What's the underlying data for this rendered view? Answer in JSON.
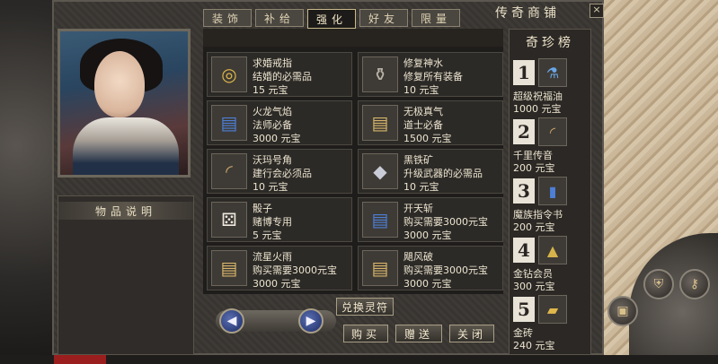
{
  "tabs": [
    {
      "label": "装饰",
      "active": false
    },
    {
      "label": "补给",
      "active": false
    },
    {
      "label": "强化",
      "active": true
    },
    {
      "label": "好友",
      "active": false
    },
    {
      "label": "限量",
      "active": false
    }
  ],
  "shop_title": "传奇商铺",
  "close_label": "×",
  "description_header": "物品说明",
  "items": [
    {
      "name": "求婚戒指",
      "desc": "结婚的必需品",
      "price": "15  元宝",
      "icon": "ring-icon"
    },
    {
      "name": "修复神水",
      "desc": "修复所有装备",
      "price": "10  元宝",
      "icon": "potion-icon"
    },
    {
      "name": "火龙气焰",
      "desc": "法师必备",
      "price": "3000  元宝",
      "icon": "book-icon"
    },
    {
      "name": "无极真气",
      "desc": "道士必备",
      "price": "1500  元宝",
      "icon": "book-icon"
    },
    {
      "name": "沃玛号角",
      "desc": "建行会必须品",
      "price": "10  元宝",
      "icon": "horn-icon"
    },
    {
      "name": "黑铁矿",
      "desc": "升级武器的必需品",
      "price": "10  元宝",
      "icon": "ore-icon"
    },
    {
      "name": "骰子",
      "desc": "赌博专用",
      "price": "5  元宝",
      "icon": "dice-icon"
    },
    {
      "name": "开天斩",
      "desc": "购买需要3000元宝",
      "price": "3000  元宝",
      "icon": "book-icon"
    },
    {
      "name": "流星火雨",
      "desc": "购买需要3000元宝",
      "price": "3000  元宝",
      "icon": "book-icon"
    },
    {
      "name": "飓风破",
      "desc": "购买需要3000元宝",
      "price": "3000  元宝",
      "icon": "book-icon"
    }
  ],
  "ranking": {
    "title": "奇珍榜",
    "entries": [
      {
        "rank": "1",
        "name": "超级祝福油",
        "price": "1000  元宝",
        "icon": "oil-bottle-icon"
      },
      {
        "rank": "2",
        "name": "千里传音",
        "price": "200  元宝",
        "icon": "horn-icon"
      },
      {
        "rank": "3",
        "name": "魔族指令书",
        "price": "200  元宝",
        "icon": "scroll-icon"
      },
      {
        "rank": "4",
        "name": "金钻会员",
        "price": "300  元宝",
        "icon": "badge-icon"
      },
      {
        "rank": "5",
        "name": "金砖",
        "price": "240  元宝",
        "icon": "gold-brick-icon"
      }
    ]
  },
  "buttons": {
    "exchange": "兑换灵符",
    "buy": "购买",
    "gift": "赠送",
    "close": "关闭"
  },
  "arrows": {
    "prev": "◀",
    "next": "▶"
  },
  "colors": {
    "panel": "#3b3834",
    "grid": "#1f1d1b",
    "accent_border": "#c8b88a",
    "arrow_blue": "#1b2a66"
  }
}
